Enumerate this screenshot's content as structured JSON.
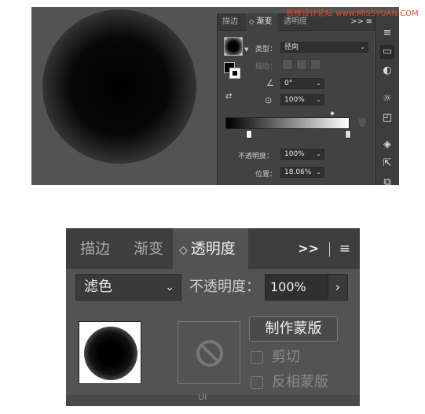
{
  "watermark": "思缘设计论坛 www.MISSYUAN.COM",
  "gradient_panel": {
    "tabs": [
      {
        "label": "描边"
      },
      {
        "label": "渐变"
      },
      {
        "label": "透明度"
      }
    ],
    "more_icon": ">>",
    "menu_icon": "≡",
    "type_label": "类型：",
    "type_value": "径向",
    "stroke_label": "描边：",
    "angle_value": "0°",
    "aspect_value": "100%",
    "opacity_label": "不透明度：",
    "opacity_value": "100%",
    "location_label": "位置：",
    "location_value": "18.06%"
  },
  "transparency_panel": {
    "tabs": [
      {
        "label": "描边"
      },
      {
        "label": "渐变"
      },
      {
        "label": "透明度"
      }
    ],
    "more_icon": ">>",
    "menu_icon": "≡",
    "blend_mode": "滤色",
    "opacity_label": "不透明度：",
    "opacity_value": "100%",
    "make_mask_label": "制作蒙版",
    "clip_label": "剪切",
    "invert_label": "反相蒙版",
    "bottom_icon": "UI"
  },
  "colors": {
    "panel_bg": "#535353",
    "tab_bar": "#3e3e3e",
    "watermark": "#e04a2a"
  }
}
